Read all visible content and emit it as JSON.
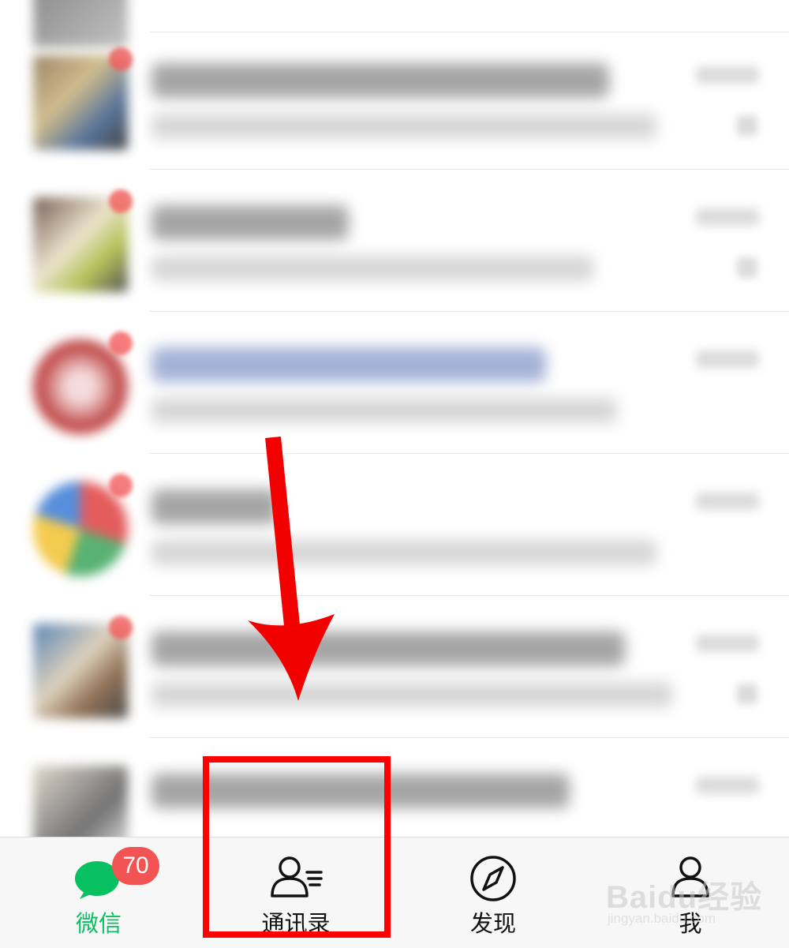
{
  "tabbar": {
    "tabs": [
      {
        "label": "微信",
        "icon": "chat-bubbles-icon",
        "badge": "70",
        "active": true
      },
      {
        "label": "通讯录",
        "icon": "contacts-icon",
        "active": false
      },
      {
        "label": "发现",
        "icon": "compass-icon",
        "active": false
      },
      {
        "label": "我",
        "icon": "person-icon",
        "active": false
      }
    ]
  },
  "colors": {
    "active_tab": "#07c160",
    "badge": "#f25353",
    "annotation": "#ff0000"
  },
  "watermark": {
    "brand": "Baidu经验",
    "site": "jingyan.baidu.com"
  }
}
